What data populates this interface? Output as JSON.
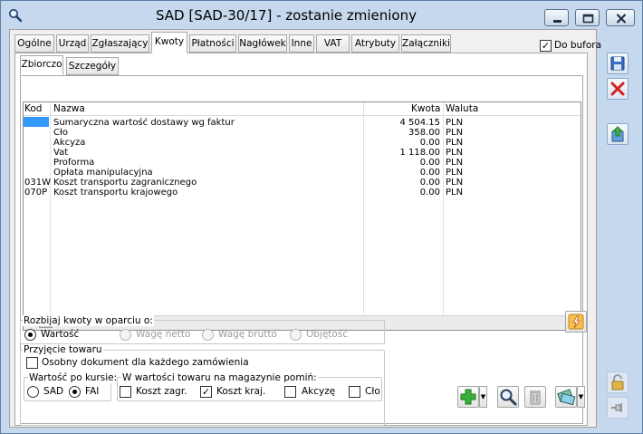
{
  "window": {
    "title": "SAD [SAD-30/17]  - zostanie zmieniony"
  },
  "tabs": [
    {
      "label": "Ogólne"
    },
    {
      "label": "Urząd"
    },
    {
      "label": "Zgłaszający"
    },
    {
      "label": "Kwoty"
    },
    {
      "label": "Płatności"
    },
    {
      "label": "Nagłówek"
    },
    {
      "label": "Inne"
    },
    {
      "label": "VAT"
    },
    {
      "label": "Atrybuty"
    },
    {
      "label": "Załączniki"
    }
  ],
  "do_bufora": {
    "label": "Do bufora",
    "checked": true
  },
  "subtabs": [
    {
      "label": "Zbiorczo"
    },
    {
      "label": "Szczegóły"
    }
  ],
  "table": {
    "columns": {
      "kod": "Kod",
      "nazwa": "Nazwa",
      "kwota": "Kwota",
      "waluta": "Waluta"
    },
    "rows": [
      {
        "kod": "",
        "nazwa": "Sumaryczna wartość dostawy wg faktur",
        "kwota": "4 504.15",
        "waluta": "PLN"
      },
      {
        "kod": "",
        "nazwa": "Cło",
        "kwota": "358.00",
        "waluta": "PLN"
      },
      {
        "kod": "",
        "nazwa": "Akcyza",
        "kwota": "0.00",
        "waluta": "PLN"
      },
      {
        "kod": "",
        "nazwa": "Vat",
        "kwota": "1 118.00",
        "waluta": "PLN"
      },
      {
        "kod": "",
        "nazwa": "Proforma",
        "kwota": "0.00",
        "waluta": "PLN"
      },
      {
        "kod": "",
        "nazwa": "Opłata manipulacyjna",
        "kwota": "0.00",
        "waluta": "PLN"
      },
      {
        "kod": "031W",
        "nazwa": "Koszt transportu zagranicznego",
        "kwota": "0.00",
        "waluta": "PLN"
      },
      {
        "kod": "070P",
        "nazwa": "Koszt transportu krajowego",
        "kwota": "0.00",
        "waluta": "PLN"
      }
    ]
  },
  "rozbijaj": {
    "label": "Rozbijaj kwoty w oparciu o:",
    "options": [
      "Wartość",
      "Wagę netto",
      "Wagę brutto",
      "Objętość"
    ],
    "selected": "Wartość"
  },
  "przyjecie": {
    "label": "Przyjęcie towaru",
    "osobny": {
      "label": "Osobny dokument dla każdego zamówienia",
      "checked": false
    }
  },
  "wartosc_po_kursie": {
    "label": "Wartość po kursie:",
    "options": [
      "SAD",
      "FAI"
    ],
    "selected": "FAI"
  },
  "pomin": {
    "label": "W wartości towaru na magazynie pomiń:",
    "options": [
      {
        "label": "Koszt zagr.",
        "checked": false
      },
      {
        "label": "Koszt kraj.",
        "checked": true
      },
      {
        "label": "Akcyzę",
        "checked": false
      },
      {
        "label": "Cło",
        "checked": false
      }
    ]
  },
  "icons": {
    "save": "save-icon",
    "cancel": "close-icon",
    "export": "export-icon",
    "lightning": "lightning-icon",
    "add": "plus-icon",
    "search": "magnifier-icon",
    "delete": "trash-icon",
    "currency": "money-icon",
    "lock": "lock-icon",
    "pin": "pin-icon"
  },
  "colors": {
    "window_frame": "#c6d8ee",
    "selection": "#3399ff",
    "add_green": "#2e9b2e",
    "cancel_red": "#d42020",
    "save_blue": "#2a5aa8"
  }
}
